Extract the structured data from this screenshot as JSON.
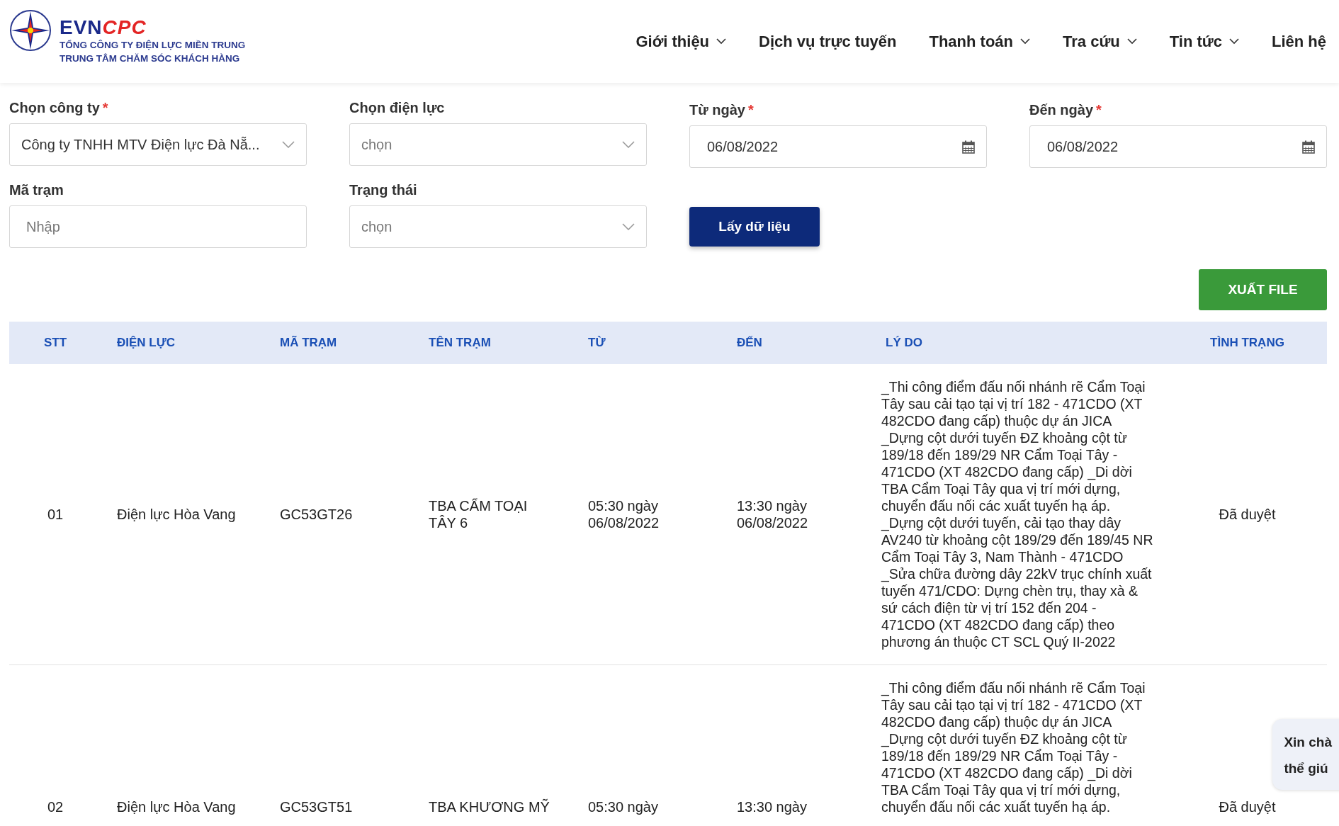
{
  "header": {
    "logo": {
      "brand_dark": "EVN",
      "brand_red": "CPC",
      "line_1": "TỔNG CÔNG TY ĐIỆN LỰC MIỀN TRUNG",
      "line_2": "TRUNG TÂM CHĂM SÓC KHÁCH HÀNG"
    },
    "nav": [
      {
        "label": "Giới thiệu",
        "dropdown": true
      },
      {
        "label": "Dịch vụ trực tuyến",
        "dropdown": false
      },
      {
        "label": "Thanh toán",
        "dropdown": true
      },
      {
        "label": "Tra cứu",
        "dropdown": true
      },
      {
        "label": "Tin tức",
        "dropdown": true
      },
      {
        "label": "Liên hệ",
        "dropdown": false
      }
    ]
  },
  "filters": [
    {
      "kind": "select",
      "label": "Chọn công ty",
      "required_mark": "*",
      "value": "Công ty TNHH MTV Điện lực Đà Nẵ..."
    },
    {
      "kind": "select",
      "label": "Chọn điện lực",
      "placeholder": "chọn"
    },
    {
      "kind": "date",
      "label": "Từ ngày",
      "required_mark": "*",
      "value": "06/08/2022"
    },
    {
      "kind": "date",
      "label": "Đến ngày",
      "required_mark": "*",
      "value": "06/08/2022"
    },
    {
      "kind": "text",
      "label": "Mã trạm",
      "placeholder": "Nhập"
    },
    {
      "kind": "select",
      "label": "Trạng thái",
      "placeholder": "chọn"
    }
  ],
  "fetch_button": "Lấy dữ liệu",
  "export_button": "XUẤT FILE",
  "table": {
    "columns": [
      "STT",
      "ĐIỆN LỰC",
      "MÃ TRẠM",
      "TÊN TRẠM",
      "TỪ",
      "ĐẾN",
      "LÝ DO",
      "TÌNH TRẠNG"
    ],
    "rows": [
      [
        "01",
        "Điện lực Hòa Vang",
        "GC53GT26",
        "TBA CẨM TOẠI TÂY 6",
        "05:30 ngày 06/08/2022",
        "13:30 ngày 06/08/2022",
        "_Thi công điểm đấu nối nhánh rẽ Cẩm Toại Tây sau cải tạo tại vị trí 182 - 471CDO (XT 482CDO đang cấp) thuộc dự án JICA _Dựng cột dưới tuyến ĐZ khoảng cột từ 189/18 đến 189/29 NR Cẩm Toại Tây - 471CDO (XT 482CDO đang cấp) _Di dời TBA Cẩm Toại Tây qua vị trí mới dựng, chuyển đấu nối các xuất tuyến hạ áp. _Dựng cột dưới tuyến, cải tạo thay dây AV240 từ khoảng cột 189/29 đến 189/45 NR Cẩm Toại Tây 3, Nam Thành - 471CDO _Sửa chữa đường dây 22kV trục chính xuất tuyến 471/CDO: Dựng chèn trụ, thay xà & sứ cách điện từ vị trí 152 đến 204 - 471CDO (XT 482CDO đang cấp) theo phương án thuộc CT SCL Quý II-2022",
        "Đã duyệt"
      ],
      [
        "02",
        "Điện lực Hòa Vang",
        "GC53GT51",
        "TBA KHƯƠNG MỸ",
        "05:30 ngày",
        "13:30 ngày",
        "_Thi công điểm đấu nối nhánh rẽ Cẩm Toại Tây sau cải tạo tại vị trí 182 - 471CDO (XT 482CDO đang cấp) thuộc dự án JICA _Dựng cột dưới tuyến ĐZ khoảng cột từ 189/18 đến 189/29 NR Cẩm Toại Tây - 471CDO (XT 482CDO đang cấp) _Di dời TBA Cẩm Toại Tây qua vị trí mới dựng, chuyển đấu nối các xuất tuyến hạ áp.",
        "Đã duyệt"
      ]
    ]
  },
  "chat_bubble": [
    "Xin chà",
    "thể giú"
  ]
}
